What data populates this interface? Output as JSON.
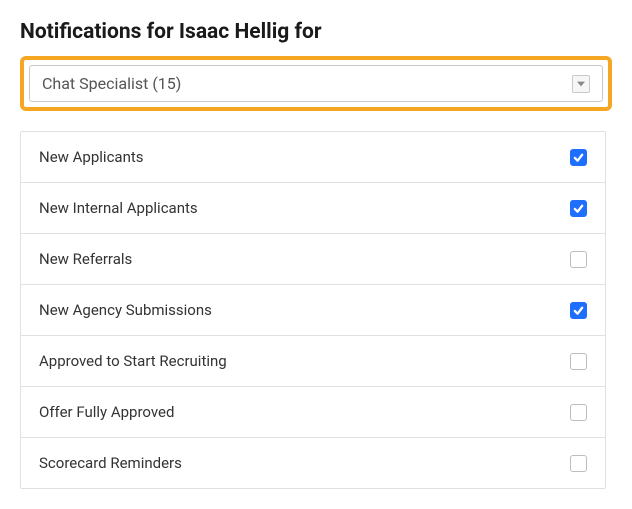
{
  "title": "Notifications for Isaac Hellig for",
  "select": {
    "value": "Chat Specialist (15)"
  },
  "notifications": [
    {
      "label": "New Applicants",
      "checked": true
    },
    {
      "label": "New Internal Applicants",
      "checked": true
    },
    {
      "label": "New Referrals",
      "checked": false
    },
    {
      "label": "New Agency Submissions",
      "checked": true
    },
    {
      "label": "Approved to Start Recruiting",
      "checked": false
    },
    {
      "label": "Offer Fully Approved",
      "checked": false
    },
    {
      "label": "Scorecard Reminders",
      "checked": false
    }
  ]
}
